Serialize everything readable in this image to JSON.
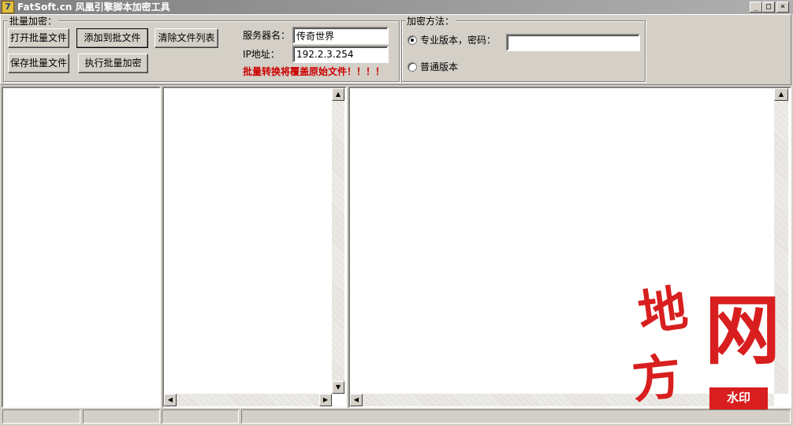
{
  "window": {
    "title": "FatSoft.cn 风凰引擎脚本加密工具",
    "icon": "app-icon",
    "icon_glyph": "7",
    "minimize_glyph": "_",
    "maximize_glyph": "□",
    "close_glyph": "×"
  },
  "batch_group": {
    "legend": "批量加密：",
    "open_batch_label": "打开批量文件",
    "add_to_batch_label": "添加到批文件",
    "clear_list_label": "清除文件列表",
    "save_batch_label": "保存批量文件",
    "run_batch_label": "执行批量加密",
    "server_name_label": "服务器名：",
    "server_name_value": "传奇世界",
    "ip_label": "IP地址：",
    "ip_value": "192.2.3.254",
    "warning": "批量转换将覆盖原始文件！！！！"
  },
  "encrypt_group": {
    "legend": "加密方法：",
    "pro_option_label": "专业版本，密码：",
    "pro_selected": true,
    "password_value": "",
    "normal_option_label": "普通版本"
  },
  "scroll": {
    "up_glyph": "▲",
    "down_glyph": "▼",
    "left_glyph": "◀",
    "right_glyph": "▶"
  },
  "watermark": {
    "chars": [
      "地",
      "方",
      "网"
    ],
    "tag": "水印",
    "color": "#d81e1e"
  },
  "colors": {
    "face": "#d4d0c8",
    "warning": "#cc0000"
  }
}
